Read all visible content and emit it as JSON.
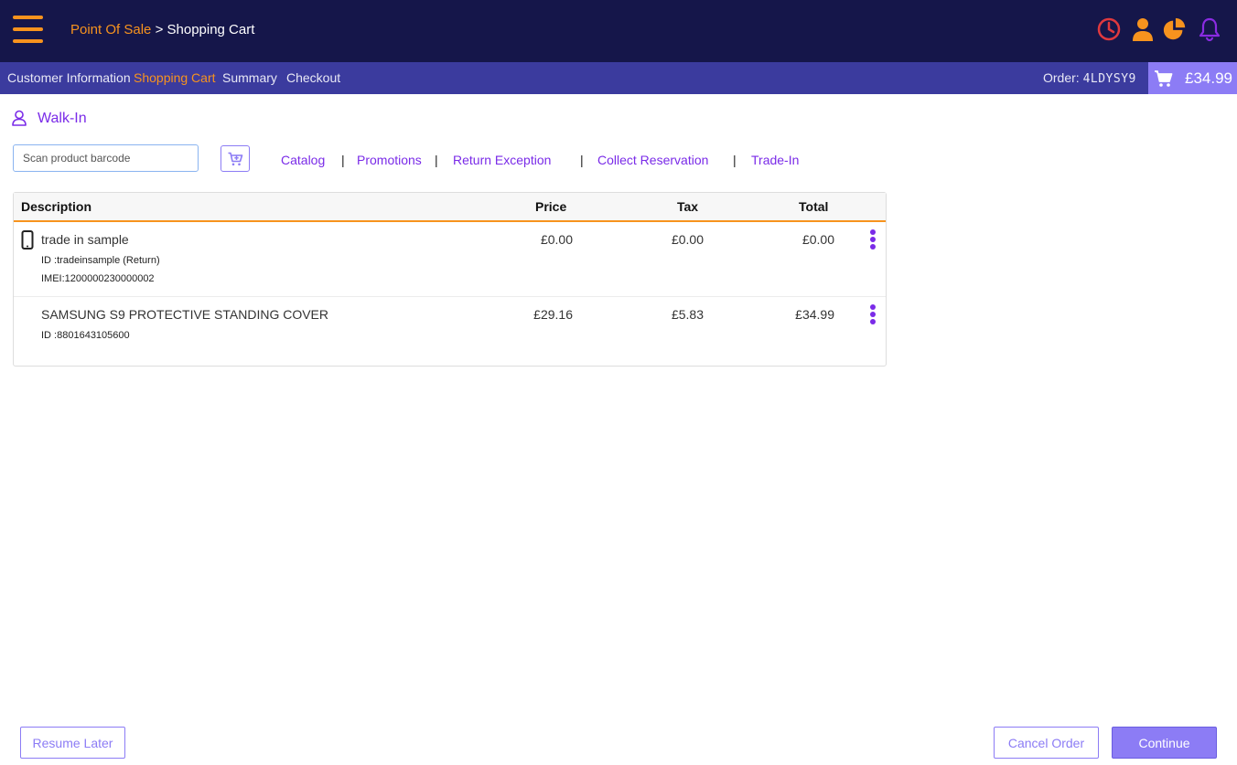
{
  "header": {
    "menu_icon": "hamburger-menu-icon",
    "breadcrumb": {
      "root": "Point Of Sale",
      "separator": ">",
      "current": "Shopping Cart"
    },
    "icons": [
      "clock-icon",
      "user-icon",
      "pie-chart-icon",
      "bell-icon"
    ],
    "colors": {
      "background": "#15164a",
      "accent": "#f7931e",
      "clock": "#e0393e",
      "bell": "#8a2be2"
    }
  },
  "subnav": {
    "tabs": [
      {
        "label": "Customer Information",
        "active": false
      },
      {
        "label": "Shopping Cart",
        "active": true
      },
      {
        "label": "Summary",
        "active": false
      },
      {
        "label": "Checkout",
        "active": false
      }
    ],
    "order_label": "Order:",
    "order_code": "4LDYSY9",
    "cart_total": "£34.99",
    "colors": {
      "background": "#3b3b9e",
      "cart_total_bg": "#8c7cf5"
    }
  },
  "customer": {
    "name": "Walk-In",
    "icon": "person-outline-icon"
  },
  "toolbar": {
    "scan_placeholder": "Scan product barcode",
    "add_icon": "cart-plus-icon",
    "links": [
      "Catalog",
      "Promotions",
      "Return Exception",
      "Collect Reservation",
      "Trade-In"
    ],
    "separator": "|"
  },
  "table": {
    "columns": [
      "Description",
      "Price",
      "Tax",
      "Total"
    ],
    "rows": [
      {
        "description": "trade in sample",
        "meta": [
          "ID :tradeinsample (Return)",
          "IMEI:1200000230000002"
        ],
        "price": "£0.00",
        "tax": "£0.00",
        "total": "£0.00",
        "icon": "mobile-phone-icon"
      },
      {
        "description": "SAMSUNG S9 PROTECTIVE STANDING COVER",
        "meta": [
          "ID :8801643105600"
        ],
        "price": "£29.16",
        "tax": "£5.83",
        "total": "£34.99",
        "icon": ""
      }
    ]
  },
  "footer": {
    "resume_later": "Resume Later",
    "cancel_order": "Cancel Order",
    "continue": "Continue"
  }
}
